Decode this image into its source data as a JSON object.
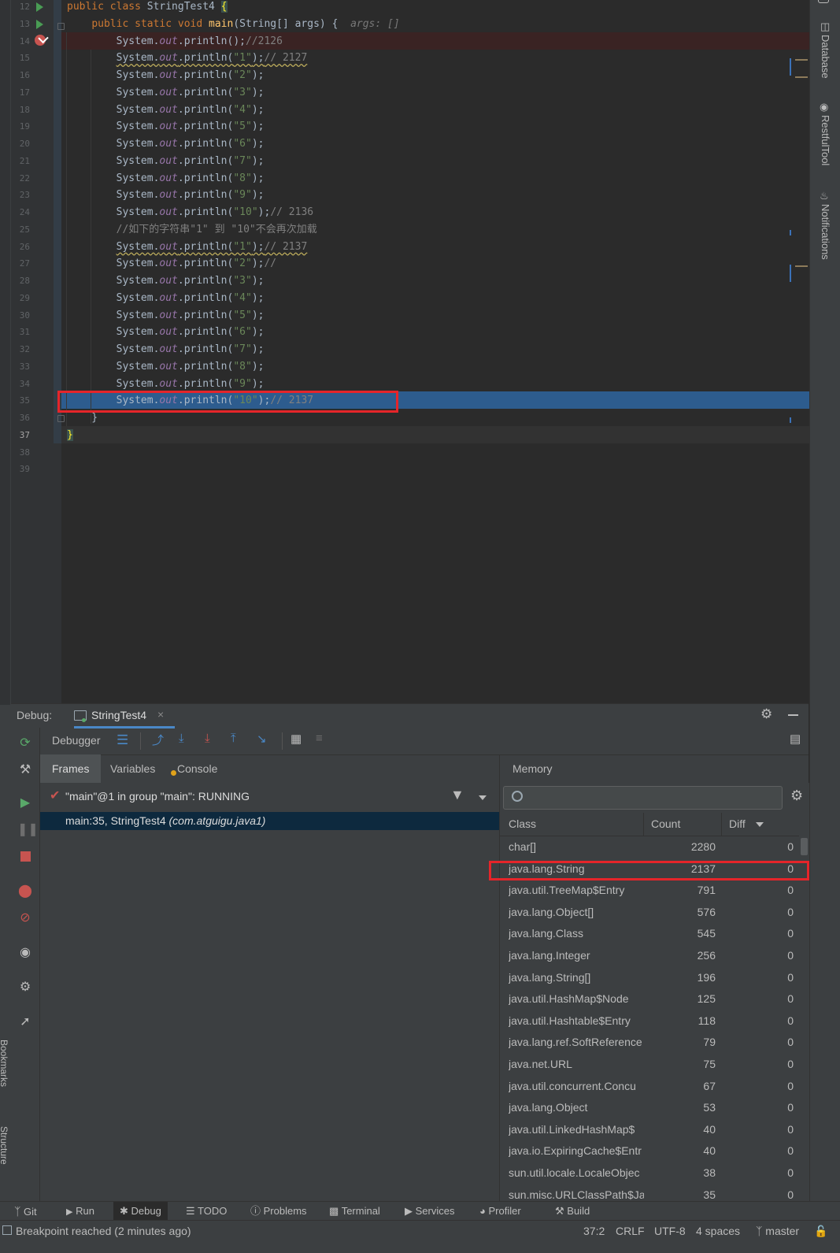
{
  "editor": {
    "lines": [
      {
        "n": "12",
        "html": "<span class='kw'>public class </span>StringTest4 <span class='yl'>{</span>"
      },
      {
        "n": "13",
        "html": "    <span class='kw'>public static void </span><span class='mth'>main</span>(String[] args) {  <span class='hint'>args: []</span>"
      },
      {
        "n": "14",
        "html": "        System.<span class='fld'>out</span>.println();<span class='cmt'>//2126</span>"
      },
      {
        "n": "15",
        "html": "        <span class='wavy'>System.<span class='fld'>out</span>.println(<span class='str'>\"1\"</span>);<span class='cmt'>// 2127</span></span>"
      },
      {
        "n": "16",
        "html": "        System.<span class='fld'>out</span>.println(<span class='str'>\"2\"</span>);"
      },
      {
        "n": "17",
        "html": "        System.<span class='fld'>out</span>.println(<span class='str'>\"3\"</span>);"
      },
      {
        "n": "18",
        "html": "        System.<span class='fld'>out</span>.println(<span class='str'>\"4\"</span>);"
      },
      {
        "n": "19",
        "html": "        System.<span class='fld'>out</span>.println(<span class='str'>\"5\"</span>);"
      },
      {
        "n": "20",
        "html": "        System.<span class='fld'>out</span>.println(<span class='str'>\"6\"</span>);"
      },
      {
        "n": "21",
        "html": "        System.<span class='fld'>out</span>.println(<span class='str'>\"7\"</span>);"
      },
      {
        "n": "22",
        "html": "        System.<span class='fld'>out</span>.println(<span class='str'>\"8\"</span>);"
      },
      {
        "n": "23",
        "html": "        System.<span class='fld'>out</span>.println(<span class='str'>\"9\"</span>);"
      },
      {
        "n": "24",
        "html": "        System.<span class='fld'>out</span>.println(<span class='str'>\"10\"</span>);<span class='cmt'>// 2136</span>"
      },
      {
        "n": "25",
        "html": "        <span class='cmt'>//如下的字符串\"1\" 到 \"10\"不会再次加载</span>"
      },
      {
        "n": "26",
        "html": "        <span class='wavy'>System.<span class='fld'>out</span>.println(<span class='str'>\"1\"</span>);<span class='cmt'>// 2137</span></span>"
      },
      {
        "n": "27",
        "html": "        System.<span class='fld'>out</span>.println(<span class='str'>\"2\"</span>);<span class='cmt'>//</span>"
      },
      {
        "n": "28",
        "html": "        System.<span class='fld'>out</span>.println(<span class='str'>\"3\"</span>);"
      },
      {
        "n": "29",
        "html": "        System.<span class='fld'>out</span>.println(<span class='str'>\"4\"</span>);"
      },
      {
        "n": "30",
        "html": "        System.<span class='fld'>out</span>.println(<span class='str'>\"5\"</span>);"
      },
      {
        "n": "31",
        "html": "        System.<span class='fld'>out</span>.println(<span class='str'>\"6\"</span>);"
      },
      {
        "n": "32",
        "html": "        System.<span class='fld'>out</span>.println(<span class='str'>\"7\"</span>);"
      },
      {
        "n": "33",
        "html": "        System.<span class='fld'>out</span>.println(<span class='str'>\"8\"</span>);"
      },
      {
        "n": "34",
        "html": "        System.<span class='fld'>out</span>.println(<span class='str'>\"9\"</span>);"
      },
      {
        "n": "35",
        "html": "        System.<span class='fld'>out</span>.println(<span class='str'>\"10\"</span>);<span class='cmt'>// 2137</span>"
      },
      {
        "n": "36",
        "html": "    }"
      },
      {
        "n": "37",
        "html": "<span class='yl'>}</span>"
      },
      {
        "n": "38",
        "html": ""
      },
      {
        "n": "39",
        "html": ""
      }
    ]
  },
  "right_tabs": {
    "database": "Database",
    "restful": "RestfulTool",
    "notifications": "Notifications"
  },
  "left_tabs": {
    "bookmarks": "Bookmarks",
    "structure": "Structure"
  },
  "debug": {
    "label": "Debug:",
    "session_tab": "StringTest4",
    "debugger_tab": "Debugger",
    "tabs": {
      "frames": "Frames",
      "variables": "Variables",
      "console": "Console"
    },
    "thread": "\"main\"@1 in group \"main\": RUNNING",
    "frame_main": "main:35, StringTest4 ",
    "frame_pkg": "(com.atguigu.java1)"
  },
  "memory": {
    "title": "Memory",
    "search_placeholder": "",
    "columns": {
      "class": "Class",
      "count": "Count",
      "diff": "Diff"
    },
    "rows": [
      {
        "cls": "char[]",
        "count": "2280",
        "diff": "0"
      },
      {
        "cls": "java.lang.String",
        "count": "2137",
        "diff": "0"
      },
      {
        "cls": "java.util.TreeMap$Entry",
        "count": "791",
        "diff": "0"
      },
      {
        "cls": "java.lang.Object[]",
        "count": "576",
        "diff": "0"
      },
      {
        "cls": "java.lang.Class",
        "count": "545",
        "diff": "0"
      },
      {
        "cls": "java.lang.Integer",
        "count": "256",
        "diff": "0"
      },
      {
        "cls": "java.lang.String[]",
        "count": "196",
        "diff": "0"
      },
      {
        "cls": "java.util.HashMap$Node",
        "count": "125",
        "diff": "0"
      },
      {
        "cls": "java.util.Hashtable$Entry",
        "count": "118",
        "diff": "0"
      },
      {
        "cls": "java.lang.ref.SoftReference",
        "count": "79",
        "diff": "0"
      },
      {
        "cls": "java.net.URL",
        "count": "75",
        "diff": "0"
      },
      {
        "cls": "java.util.concurrent.Concu",
        "count": "67",
        "diff": "0"
      },
      {
        "cls": "java.lang.Object",
        "count": "53",
        "diff": "0"
      },
      {
        "cls": "java.util.LinkedHashMap$",
        "count": "40",
        "diff": "0"
      },
      {
        "cls": "java.io.ExpiringCache$Entr",
        "count": "40",
        "diff": "0"
      },
      {
        "cls": "sun.util.locale.LocaleObjec",
        "count": "38",
        "diff": "0"
      },
      {
        "cls": "sun.misc.URLClassPath$Ja",
        "count": "35",
        "diff": "0"
      }
    ]
  },
  "tool_windows": {
    "git": "Git",
    "run": "Run",
    "debug": "Debug",
    "todo": "TODO",
    "problems": "Problems",
    "terminal": "Terminal",
    "services": "Services",
    "profiler": "Profiler",
    "build": "Build"
  },
  "status": {
    "message": "Breakpoint reached (2 minutes ago)",
    "position": "37:2",
    "line_sep": "CRLF",
    "encoding": "UTF-8",
    "indent": "4 spaces",
    "branch": "master"
  },
  "colors": {
    "accent": "#2d5c8e",
    "highlight_box": "#e5252a",
    "background": "#2b2b2b",
    "panel": "#3c3f41"
  }
}
